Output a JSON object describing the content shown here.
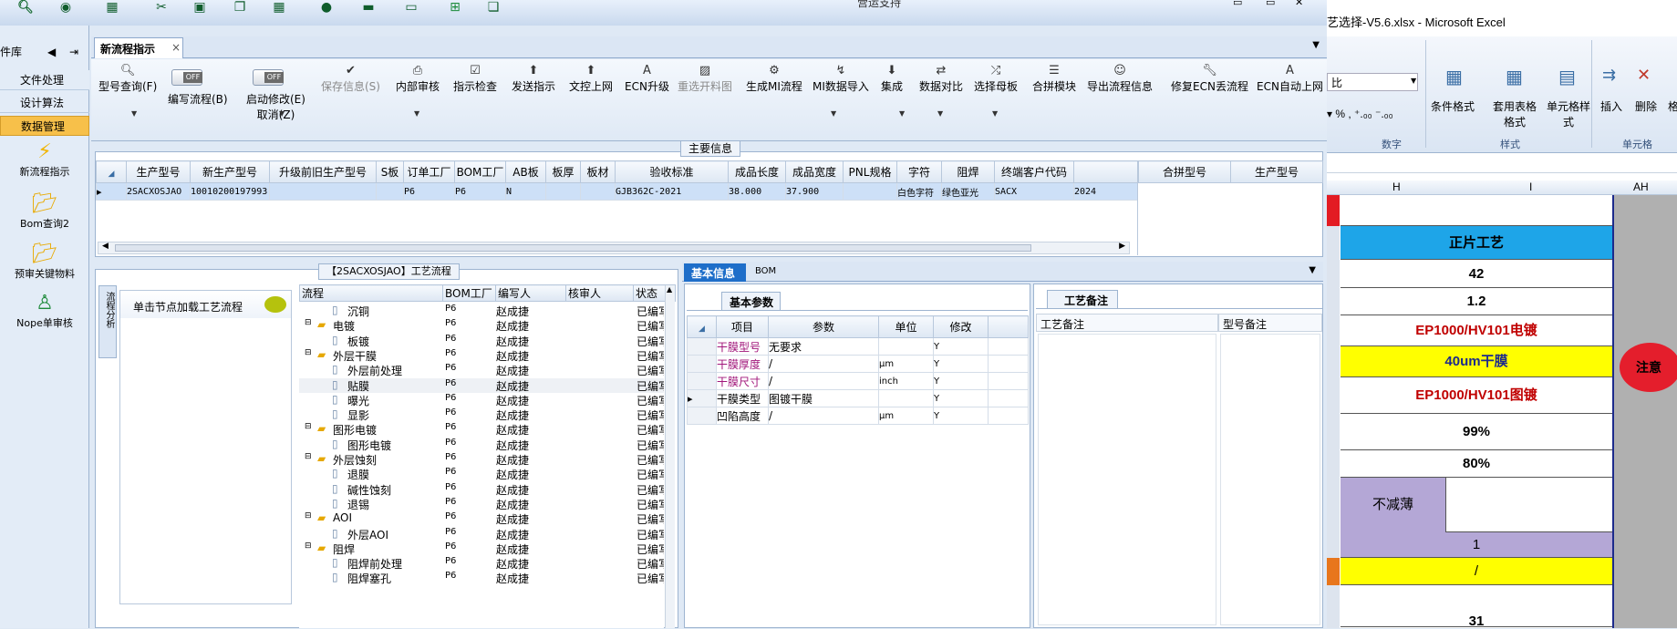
{
  "toolbar": {
    "center_title": "营运支持"
  },
  "nav": {
    "section": "件库",
    "items": [
      "文件处理",
      "设计算法",
      "数据管理"
    ],
    "big": [
      "新流程指示",
      "Bom查询2",
      "预审关键物料",
      "Nope单审核"
    ]
  },
  "tab": {
    "label": "新流程指示",
    "close": "×"
  },
  "ribbon": {
    "buttons": [
      {
        "icon": "search-icon",
        "label": "型号查询(F)",
        "disabled": false
      },
      {
        "icon": "",
        "label": "编写流程(B)",
        "disabled": false
      },
      {
        "icon": "",
        "label": "启动修改(E)",
        "sub": "取消(Z)",
        "disabled": false
      },
      {
        "icon": "check-icon",
        "label": "保存信息(S)",
        "disabled": true
      },
      {
        "icon": "print-icon",
        "label": "内部审核",
        "disabled": false
      },
      {
        "icon": "checkbox-icon",
        "label": "指示检查",
        "disabled": false
      },
      {
        "icon": "upload-icon",
        "label": "发送指示",
        "disabled": false
      },
      {
        "icon": "upload-icon",
        "label": "文控上网",
        "disabled": false
      },
      {
        "icon": "font-icon",
        "label": "ECN升级",
        "disabled": false
      },
      {
        "icon": "image-icon",
        "label": "重选开料图",
        "disabled": true
      },
      {
        "icon": "gears-icon",
        "label": "生成MI流程",
        "disabled": false
      },
      {
        "icon": "import-icon",
        "label": "MI数据导入",
        "disabled": false
      },
      {
        "icon": "download-icon",
        "label": "集成",
        "disabled": false
      },
      {
        "icon": "compare-icon",
        "label": "数据对比",
        "disabled": false
      },
      {
        "icon": "shuffle-icon",
        "label": "选择母板",
        "disabled": false
      },
      {
        "icon": "list-icon",
        "label": "合拼模块",
        "disabled": false
      },
      {
        "icon": "smile-icon",
        "label": "导出流程信息",
        "disabled": false
      },
      {
        "icon": "wrench-icon",
        "label": "修复ECN丢流程",
        "disabled": false
      },
      {
        "icon": "font-icon",
        "label": "ECN自动上网",
        "disabled": false
      }
    ],
    "toggle_text": "OFF"
  },
  "main_info": {
    "title": "主要信息",
    "columns": [
      "生产型号",
      "新生产型号",
      "升级前旧生产型号",
      "S板",
      "订单工厂",
      "BOM工厂",
      "AB板",
      "板厚",
      "板材",
      "验收标准",
      "成品长度",
      "成品宽度",
      "PNL规格",
      "字符",
      "阻焊",
      "终端客户代码"
    ],
    "row": [
      "2SACXOSJAO",
      "10010200197993",
      "",
      "",
      "P6",
      "P6",
      "N",
      "",
      "",
      "GJB362C-2021",
      "38.000",
      "37.900",
      "",
      "白色字符",
      "绿色亚光",
      "SACX",
      "2024"
    ],
    "side_columns": [
      "合拼型号",
      "生产型号"
    ]
  },
  "process": {
    "title": "【2SACXOSJAO】工艺流程",
    "hint": "单击节点加载工艺流程",
    "vertical_tab": "流程分析",
    "columns": [
      "流程",
      "BOM工厂",
      "编写人",
      "核审人",
      "状态"
    ],
    "rows": [
      {
        "name": "沉铜",
        "indent": 2,
        "factory": "P6",
        "writer": "赵成捷",
        "status": "已编写"
      },
      {
        "name": "电镀",
        "indent": 1,
        "factory": "P6",
        "writer": "赵成捷",
        "status": "已编写"
      },
      {
        "name": "板镀",
        "indent": 2,
        "factory": "P6",
        "writer": "赵成捷",
        "status": "已编写"
      },
      {
        "name": "外层干膜",
        "indent": 1,
        "factory": "P6",
        "writer": "赵成捷",
        "status": "已编写"
      },
      {
        "name": "外层前处理",
        "indent": 2,
        "factory": "P6",
        "writer": "赵成捷",
        "status": "已编写"
      },
      {
        "name": "贴膜",
        "indent": 2,
        "factory": "P6",
        "writer": "赵成捷",
        "status": "已编写"
      },
      {
        "name": "曝光",
        "indent": 2,
        "factory": "P6",
        "writer": "赵成捷",
        "status": "已编写"
      },
      {
        "name": "显影",
        "indent": 2,
        "factory": "P6",
        "writer": "赵成捷",
        "status": "已编写"
      },
      {
        "name": "图形电镀",
        "indent": 1,
        "factory": "P6",
        "writer": "赵成捷",
        "status": "已编写"
      },
      {
        "name": "图形电镀",
        "indent": 2,
        "factory": "P6",
        "writer": "赵成捷",
        "status": "已编写"
      },
      {
        "name": "外层蚀刻",
        "indent": 1,
        "factory": "P6",
        "writer": "赵成捷",
        "status": "已编写"
      },
      {
        "name": "退膜",
        "indent": 2,
        "factory": "P6",
        "writer": "赵成捷",
        "status": "已编写"
      },
      {
        "name": "碱性蚀刻",
        "indent": 2,
        "factory": "P6",
        "writer": "赵成捷",
        "status": "已编写"
      },
      {
        "name": "退锡",
        "indent": 2,
        "factory": "P6",
        "writer": "赵成捷",
        "status": "已编写"
      },
      {
        "name": "AOI",
        "indent": 1,
        "factory": "P6",
        "writer": "赵成捷",
        "status": "已编写"
      },
      {
        "name": "外层AOI",
        "indent": 2,
        "factory": "P6",
        "writer": "赵成捷",
        "status": "已编写"
      },
      {
        "name": "阻焊",
        "indent": 1,
        "factory": "P6",
        "writer": "赵成捷",
        "status": "已编写"
      },
      {
        "name": "阻焊前处理",
        "indent": 2,
        "factory": "P6",
        "writer": "赵成捷",
        "status": "已编写"
      },
      {
        "name": "阻焊塞孔",
        "indent": 2,
        "factory": "P6",
        "writer": "赵成捷",
        "status": "已编写"
      }
    ]
  },
  "basic": {
    "tabs": [
      "基本信息",
      "BOM"
    ],
    "subtab": "基本参数",
    "columns": [
      "项目",
      "参数",
      "单位",
      "修改"
    ],
    "rows": [
      {
        "item": "干膜型号",
        "value": "无要求",
        "unit": "",
        "mod": "Y"
      },
      {
        "item": "干膜厚度",
        "value": "/",
        "unit": "μm",
        "mod": "Y"
      },
      {
        "item": "干膜尺寸",
        "value": "/",
        "unit": "inch",
        "mod": "Y"
      },
      {
        "item": "干膜类型",
        "value": "图镀干膜",
        "unit": "",
        "mod": "Y"
      },
      {
        "item": "凹陷高度",
        "value": "/",
        "unit": "μm",
        "mod": "Y"
      }
    ],
    "note_tab": "工艺备注",
    "note_columns": [
      "工艺备注",
      "型号备注"
    ]
  },
  "excel": {
    "title": "艺选择-V5.6.xlsx - Microsoft Excel",
    "font_box": "比",
    "groups": [
      "数字",
      "样式",
      "单元格"
    ],
    "ribbon_btns": [
      "条件格式",
      "套用表格格式",
      "单元格样式",
      "插入",
      "删除",
      "格"
    ],
    "cols": [
      "H",
      "I",
      "AH"
    ],
    "cells": [
      "正片工艺",
      "42",
      "1.2",
      "EP1000/HV101电镀",
      "40um干膜",
      "EP1000/HV101图镀",
      "99%",
      "80%",
      "不减薄",
      "1",
      "/",
      "31"
    ],
    "callout": "注意"
  },
  "colors": {
    "accent": "#1e6ec9",
    "excel_blue": "#1ea5e8",
    "excel_yellow": "#ffff00",
    "excel_red": "#c00000",
    "excel_purple": "#b4a7d6"
  }
}
